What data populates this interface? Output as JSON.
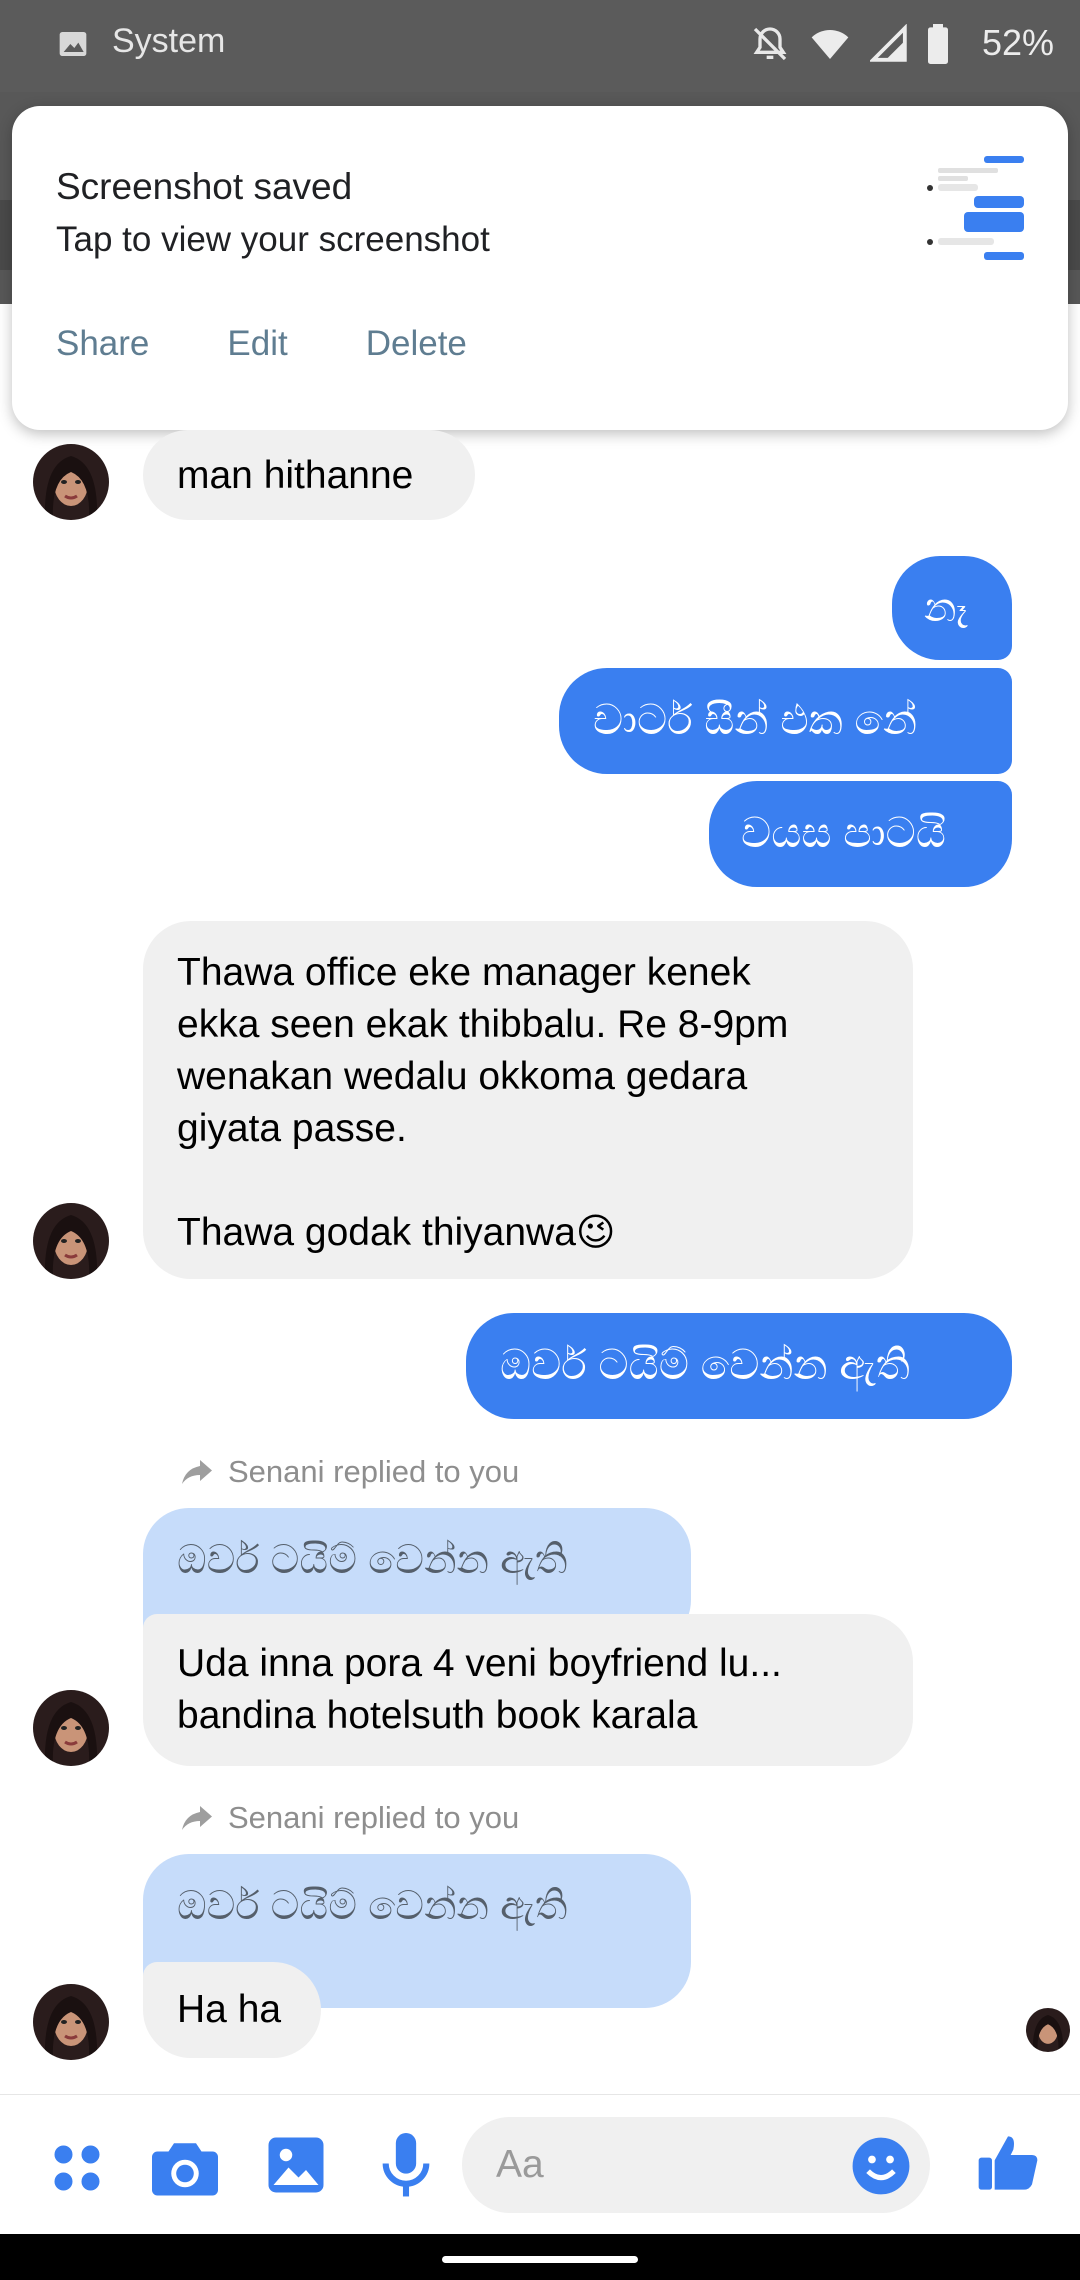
{
  "status_bar": {
    "app_label": "System",
    "battery": "52%",
    "icons": [
      "image-icon",
      "dnd-off-icon",
      "wifi-icon",
      "signal-icon",
      "battery-icon"
    ]
  },
  "notification": {
    "title": "Screenshot saved",
    "subtitle": "Tap to view your screenshot",
    "actions": {
      "share": "Share",
      "edit": "Edit",
      "delete": "Delete"
    }
  },
  "messages": {
    "m1": "man hithanne",
    "m2": "නෑ",
    "m3": "චාටර්  සීන් එක නේ",
    "m4": "වයස පාටයි",
    "m5_line1": "Thawa office eke manager kenek",
    "m5_line2": "ekka seen ekak thibbalu. Re 8-9pm",
    "m5_line3": "wenakan wedalu okkoma gedara",
    "m5_line4": "giyata passe.",
    "m5_line5": "Thawa godak thiyanwa",
    "m5_emoji": "😉",
    "m6": "ඔවර් ටයිම් වෙන්න ඇති",
    "reply1_label": "Senani replied to you",
    "reply1_quote": "ඔවර් ටයිම් වෙන්න ඇති",
    "reply1_line1": "Uda inna pora 4 veni boyfriend lu...",
    "reply1_line2": "bandina hotelsuth book karala",
    "reply2_label": "Senani replied to you",
    "reply2_quote": "ඔවර් ටයිම් වෙන්න ඇති",
    "reply2_text": "Ha ha"
  },
  "composer": {
    "placeholder": "Aa",
    "icons": [
      "apps-icon",
      "camera-icon",
      "gallery-icon",
      "microphone-icon",
      "emoji-icon",
      "thumbs-up-icon"
    ]
  },
  "colors": {
    "outgoing_bubble": "#3a7ff0",
    "incoming_bubble": "#f0f0f0",
    "reply_quote": "#c6dcfa",
    "accent": "#3a7ff0"
  }
}
